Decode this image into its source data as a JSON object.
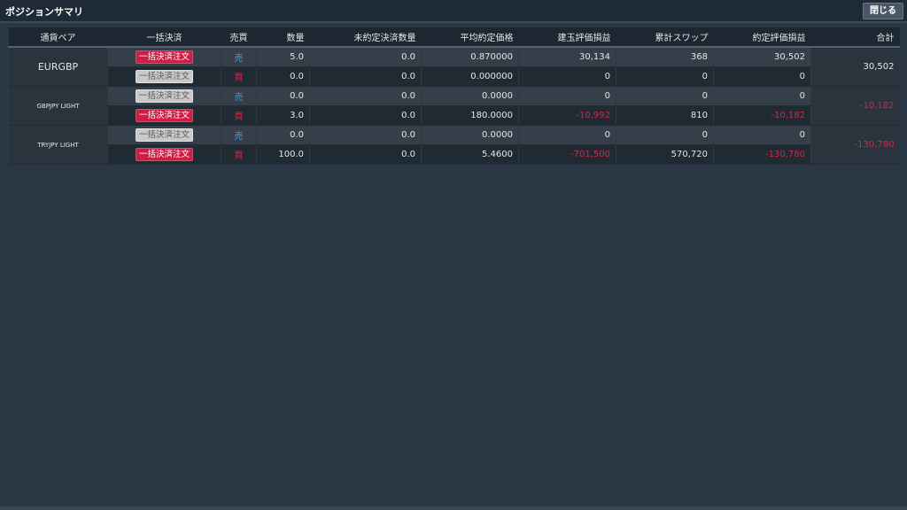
{
  "window": {
    "title": "ポジションサマリ",
    "close_label": "閉じる"
  },
  "colors": {
    "negative": "#d2274a",
    "sell": "#3aa3d6",
    "buy": "#d2274a",
    "bulk_active": "#cc1f44"
  },
  "table": {
    "headers": {
      "pair": "通貨ペア",
      "bulk": "一括決済",
      "side": "売買",
      "qty": "数量",
      "unsettled": "未約定決済数量",
      "avg_price": "平均約定価格",
      "unrealized": "建玉評価損益",
      "swap": "累計スワップ",
      "settled": "約定評価損益",
      "total": "合計"
    },
    "groups": [
      {
        "pair": "EURGBP",
        "total": "30,502",
        "rows": [
          {
            "bulk": "一括決済注文",
            "side": "売",
            "qty": "5.0",
            "unsettled": "0.0",
            "avg_price": "0.870000",
            "unrealized": "30,134",
            "swap": "368",
            "settled": "30,502"
          },
          {
            "bulk": "一括決済注文",
            "side": "買",
            "qty": "0.0",
            "unsettled": "0.0",
            "avg_price": "0.000000",
            "unrealized": "0",
            "swap": "0",
            "settled": "0"
          }
        ]
      },
      {
        "pair": "GBPJPY LIGHT",
        "total": "-10,182",
        "rows": [
          {
            "bulk": "一括決済注文",
            "side": "売",
            "qty": "0.0",
            "unsettled": "0.0",
            "avg_price": "0.0000",
            "unrealized": "0",
            "swap": "0",
            "settled": "0"
          },
          {
            "bulk": "一括決済注文",
            "side": "買",
            "qty": "3.0",
            "unsettled": "0.0",
            "avg_price": "180.0000",
            "unrealized": "-10,992",
            "swap": "810",
            "settled": "-10,182"
          }
        ]
      },
      {
        "pair": "TRYJPY LIGHT",
        "total": "-130,780",
        "rows": [
          {
            "bulk": "一括決済注文",
            "side": "売",
            "qty": "0.0",
            "unsettled": "0.0",
            "avg_price": "0.0000",
            "unrealized": "0",
            "swap": "0",
            "settled": "0"
          },
          {
            "bulk": "一括決済注文",
            "side": "買",
            "qty": "100.0",
            "unsettled": "0.0",
            "avg_price": "5.4600",
            "unrealized": "-701,500",
            "swap": "570,720",
            "settled": "-130,780"
          }
        ]
      }
    ]
  }
}
